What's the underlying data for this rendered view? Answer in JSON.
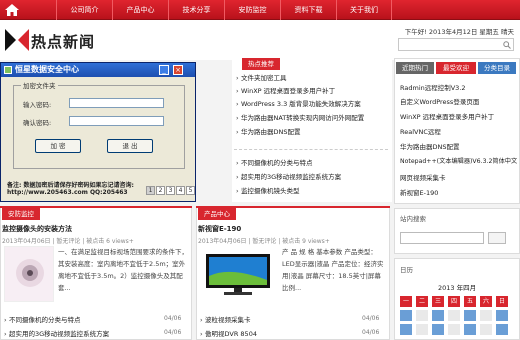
{
  "nav": {
    "items": [
      "公司简介",
      "产品中心",
      "技术分享",
      "安防监控",
      "资料下载",
      "关于我们"
    ]
  },
  "header": {
    "logo_text": "热点新闻",
    "date": "下午好! 2013年4月12日 星期五 晴天"
  },
  "window": {
    "title": "恒星数据安全中心",
    "group_label": "加密文件夹",
    "input_label": "输入密码:",
    "confirm_label": "确认密码:",
    "encrypt_button": "加 密",
    "exit_button": "退 出",
    "memo": "备注: 数据加密后请保存好密码如果忘记请咨询:",
    "memo2": "http://www.205463.com  QQ:205463"
  },
  "slider_pages": [
    "1",
    "2",
    "3",
    "4",
    "5"
  ],
  "hot": {
    "tag": "热点推荐",
    "items": [
      "文件夹加密工具",
      "WinXP 远程桌面登录多用户补丁",
      "WordPress 3.3 版背景功能失效解决方案",
      "华为路由器NAT转换实现内网访问外网配置",
      "华为路由器DNS配置"
    ],
    "items2": [
      "不同摄像机的分类与特点",
      "超实用的3G移动视频监控系统方案",
      "监控摄像机镜头类型"
    ]
  },
  "right": {
    "tabs": [
      "近期热门",
      "最受欢迎",
      "分类目录"
    ],
    "items": [
      "Radmin远程控制V3.2",
      "自定义WordPress登录页面",
      "WinXP 远程桌面登录多用户补丁",
      "RealVNC远程",
      "华为路由器DNS配置",
      "Notepad++(文本编辑器)V6.3.2简体中文",
      "网页视频采集卡",
      "新视窗E-190"
    ],
    "search_title": "站内搜索",
    "calendar_title": "日历",
    "calendar_month": "2013 年四月",
    "weekdays": [
      "一",
      "二",
      "三",
      "四",
      "五",
      "六",
      "日"
    ]
  },
  "sec1": {
    "tag": "安防监控",
    "title": "监控摄像头的安装方法",
    "meta": "2013年04月06日 | 暂无评论 | 被点击 6 views+",
    "desc": "一、在满足监视目标视场范围要求的条件下，其安装高度：室内离地不宜低于2.5m；室外离地不宜低于3.5m。2）监控摄像头及其配套...",
    "items": [
      "不同摄像机的分类与特点",
      "超实用的3G移动视频监控系统方案"
    ],
    "dates": [
      "04/06",
      "04/06"
    ]
  },
  "sec2": {
    "tag": "产品中心",
    "title": "新视窗E-190",
    "meta": "2013年04月06日 | 暂无评论 | 被点击 9 views+",
    "desc": "产 品 规 格 基本参数 产品类型：LED显示器|液晶 产品定位：经济实用|液晶 屏幕尺寸：18.5英寸|屏幕比例...",
    "items": [
      "波粒视频采集卡",
      "傲明视DVR 8504"
    ],
    "dates": [
      "04/06",
      "04/06"
    ]
  },
  "colors": {
    "brand": "#d8262e",
    "nav": "#c8141d"
  }
}
